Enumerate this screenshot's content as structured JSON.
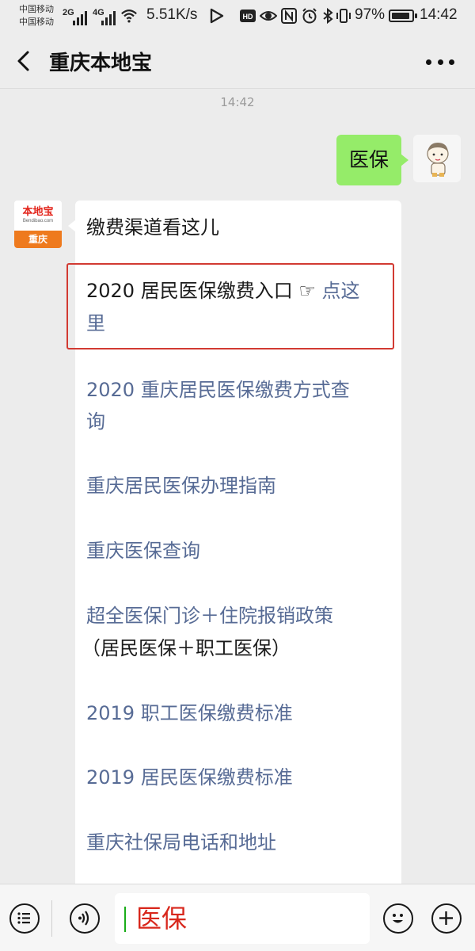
{
  "status_bar": {
    "carrier_1": "中国移动",
    "carrier_2": "中国移动",
    "signal_1": "2G",
    "signal_2": "4G",
    "net_speed": "5.51K/s",
    "battery": "97%",
    "time": "14:42",
    "icons": [
      "signal-icon",
      "wifi-icon",
      "video-icon",
      "hd-icon",
      "eye-icon",
      "nfc-icon",
      "alarm-icon",
      "bluetooth-icon",
      "vibrate-icon",
      "battery-icon"
    ]
  },
  "nav": {
    "title": "重庆本地宝"
  },
  "chat": {
    "timestamp": "14:42",
    "sent_message": "医保",
    "bot_avatar": {
      "logo_text": "本地宝",
      "logo_url": "Bendibao.com",
      "city": "重庆"
    },
    "reply": {
      "intro": "缴费渠道看这儿",
      "entry_line_1": "2020 居民医保缴费入口",
      "entry_pointer": "☞",
      "entry_link_1": "点这",
      "entry_link_2": "里",
      "links": [
        {
          "line1": "2020 重庆居民医保缴费方式查",
          "line2": "询"
        },
        {
          "line1": "重庆居民医保办理指南",
          "line2": ""
        },
        {
          "line1": "重庆医保查询",
          "line2": ""
        },
        {
          "line1": "超全医保门诊＋住院报销政策",
          "line2": "（居民医保＋职工医保）"
        },
        {
          "line1": "2019 职工医保缴费标准",
          "line2": ""
        },
        {
          "line1": "2019 居民医保缴费标准",
          "line2": ""
        },
        {
          "line1": "重庆社保局电话和地址",
          "line2": ""
        }
      ]
    }
  },
  "input_bar": {
    "text": "医保"
  },
  "colors": {
    "sent_bubble": "#95ec69",
    "link": "#576b95",
    "highlight_border": "#d23a32",
    "input_text": "#d8271c"
  }
}
